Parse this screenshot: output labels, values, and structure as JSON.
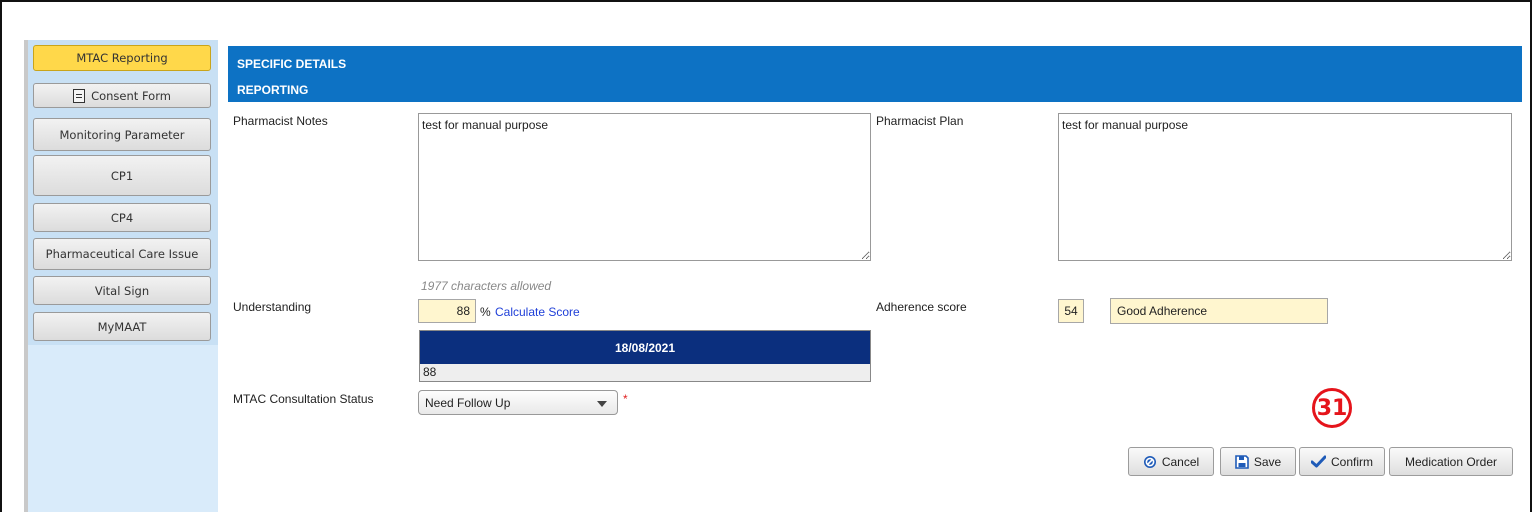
{
  "sidebar": {
    "items": [
      {
        "label": "MTAC Reporting",
        "active": true
      },
      {
        "label": "Consent Form",
        "icon": "document-icon"
      },
      {
        "label": "Monitoring Parameter"
      },
      {
        "label": "CP1"
      },
      {
        "label": "CP4"
      },
      {
        "label": "Pharmaceutical Care Issue"
      },
      {
        "label": "Vital Sign"
      },
      {
        "label": "MyMAAT"
      }
    ]
  },
  "header": {
    "title": "SPECIFIC DETAILS",
    "subtitle": "REPORTING"
  },
  "form": {
    "pharmacist_notes_label": "Pharmacist Notes",
    "pharmacist_notes_value": "test for manual purpose",
    "pharmacist_plan_label": "Pharmacist Plan",
    "pharmacist_plan_value": "test for manual purpose",
    "chars_allowed": "1977 characters allowed",
    "understanding_label": "Understanding",
    "understanding_value": "88",
    "percent_sign": "%",
    "calculate_score": "Calculate Score",
    "adherence_label": "Adherence score",
    "adherence_value": "54",
    "adherence_text": "Good Adherence",
    "history_date": "18/08/2021",
    "history_value": "88",
    "consultation_status_label": "MTAC Consultation Status",
    "consultation_status_value": "Need Follow Up",
    "required_mark": "*"
  },
  "annotation": {
    "step_number": "31",
    "color": "#e5141b"
  },
  "actions": {
    "cancel": "Cancel",
    "save": "Save",
    "confirm": "Confirm",
    "medication_order": "Medication Order"
  },
  "colors": {
    "header_blue": "#0d72c4",
    "active_tab": "#ffd84a",
    "table_head": "#0b2f7e",
    "field_yellow": "#fff6cf"
  }
}
